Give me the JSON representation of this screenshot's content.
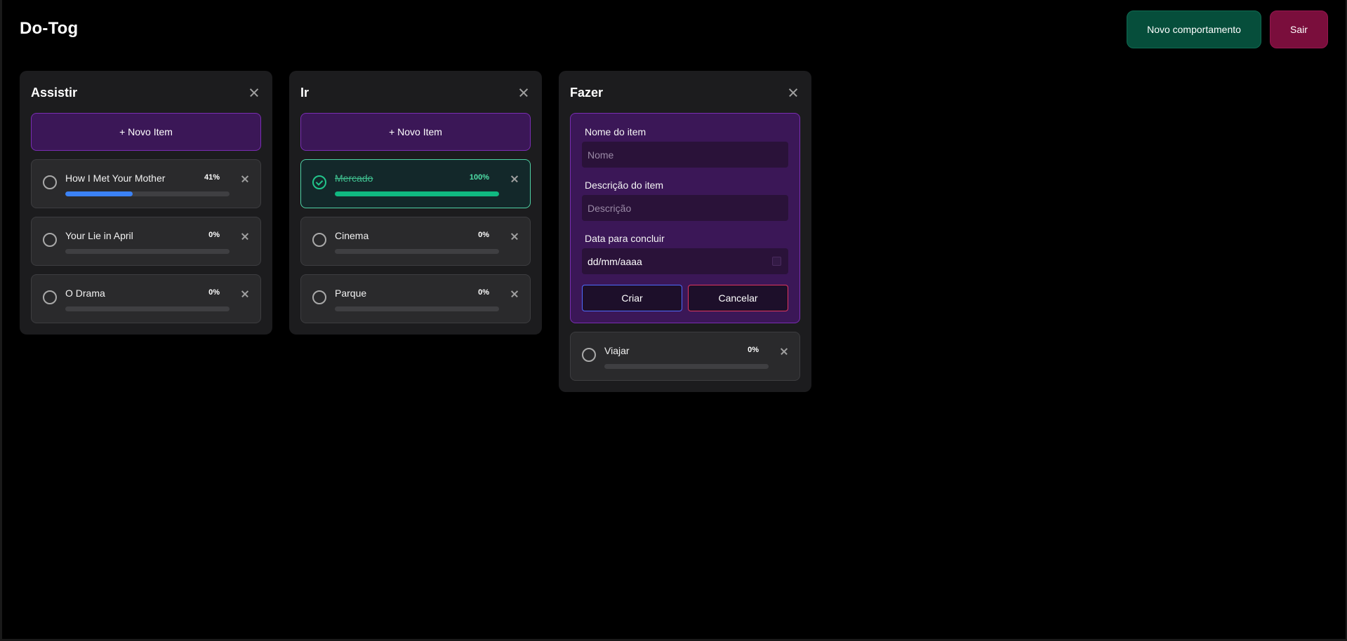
{
  "header": {
    "app_title": "Do-Tog",
    "new_behavior_label": "Novo comportamento",
    "logout_label": "Sair"
  },
  "columns": [
    {
      "title": "Assistir",
      "add_item_label": "+ Novo Item",
      "items": [
        {
          "name": "How I Met Your Mother",
          "progress_label": "41%",
          "progress": 0.41,
          "done": false
        },
        {
          "name": "Your Lie in April",
          "progress_label": "0%",
          "progress": 0,
          "done": false
        },
        {
          "name": "O Drama",
          "progress_label": "0%",
          "progress": 0,
          "done": false
        }
      ]
    },
    {
      "title": "Ir",
      "add_item_label": "+ Novo Item",
      "items": [
        {
          "name": "Mercado",
          "progress_label": "100%",
          "progress": 1,
          "done": true
        },
        {
          "name": "Cinema",
          "progress_label": "0%",
          "progress": 0,
          "done": false
        },
        {
          "name": "Parque",
          "progress_label": "0%",
          "progress": 0,
          "done": false
        }
      ]
    },
    {
      "title": "Fazer",
      "form": {
        "name_label": "Nome do item",
        "name_placeholder": "Nome",
        "description_label": "Descrição do item",
        "description_placeholder": "Descrição",
        "date_label": "Data para concluir",
        "date_value": "dd/mm/aaaa",
        "create_label": "Criar",
        "cancel_label": "Cancelar"
      },
      "items": [
        {
          "name": "Viajar",
          "progress_label": "0%",
          "progress": 0,
          "done": false
        }
      ]
    }
  ],
  "colors": {
    "background": "#000000",
    "column_bg": "#1c1c1e",
    "accent_purple": "#3b1757",
    "progress_blue": "#3b82f6",
    "progress_green": "#10b981",
    "new_behavior_bg": "#064e3b",
    "logout_bg": "#7a0e3c"
  }
}
